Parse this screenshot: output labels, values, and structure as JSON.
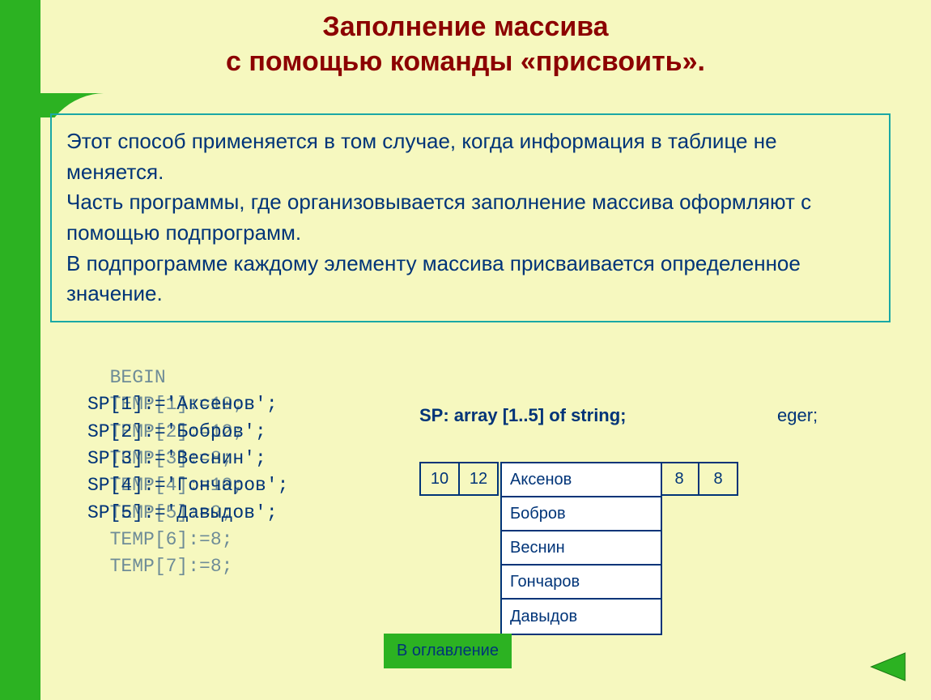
{
  "title_line1": "Заполнение массива",
  "title_line2": "с  помощью команды «присвоить».",
  "info": "Этот способ применяется в том случае, когда информация в таблице не меняется.\nЧасть программы, где организовывается заполнение массива оформляют с помощью подпрограмм.\nВ подпрограмме  каждому элементу массива присваивается определенное значение.",
  "code_back": "  BEGIN\n  TEMP[1]:=10;\n  TEMP[2]:=12;\n  TEMP[3]:=8;\n  TEMP[4]:=10;\n  TEMP[5]:=9;\n  TEMP[6]:=8;\n  TEMP[7]:=8;",
  "code_front": "\nSP[1]:='Аксенов';\nSP[2]:='Бобров';\nSP[3]:='Веснин';\nSP[4]:='Гончаров';\nSP[5]:='Давыдов';",
  "decl": "SP:  array [1..5] of string;",
  "decl_tail": "eger;",
  "numbers": [
    "10",
    "12",
    "8",
    "8"
  ],
  "names": [
    "Аксенов",
    "Бобров",
    "Веснин",
    "Гончаров",
    "Давыдов"
  ],
  "back_button": "В оглавление"
}
